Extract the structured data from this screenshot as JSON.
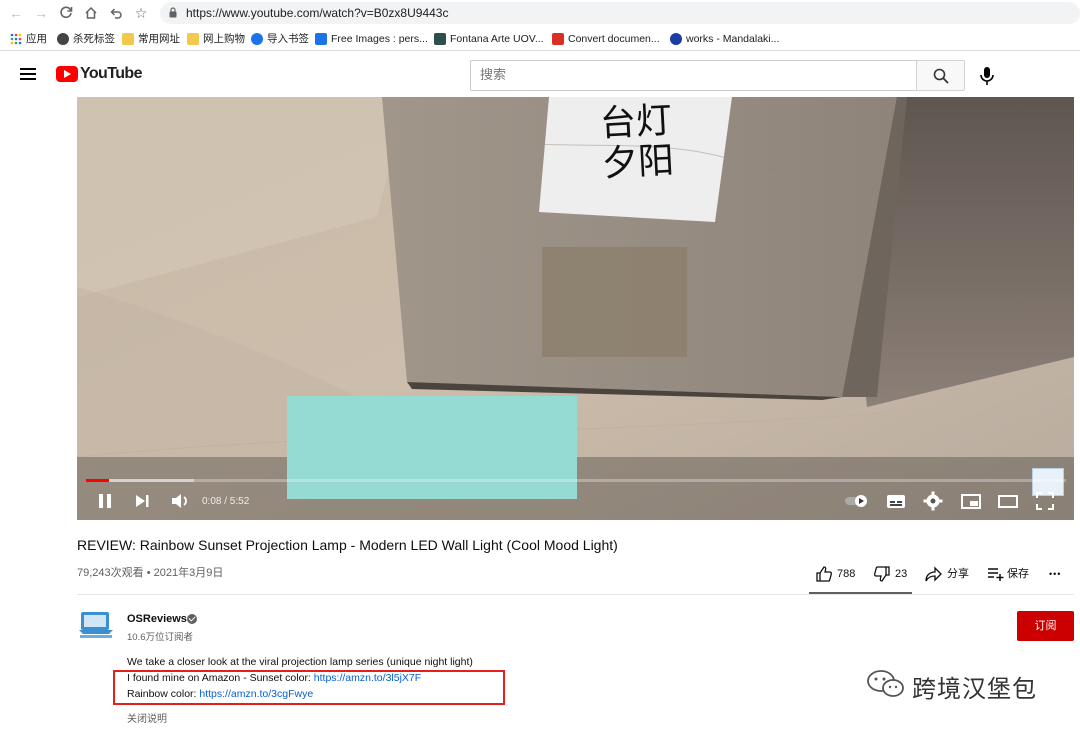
{
  "browser": {
    "url": "https://www.youtube.com/watch?v=B0zx8U9443c",
    "bookmarks": [
      {
        "label": "应用",
        "color": "#1a73e8"
      },
      {
        "label": "杀死标签",
        "color": "#444444"
      },
      {
        "label": "常用网址",
        "color": "#f2c94c"
      },
      {
        "label": "网上购物",
        "color": "#f2c94c"
      },
      {
        "label": "导入书签",
        "color": "#1a73e8"
      },
      {
        "label": "Free Images : pers...",
        "color": "#1a73e8"
      },
      {
        "label": "Fontana Arte UOV...",
        "color": "#2f4f4f"
      },
      {
        "label": "Convert documen...",
        "color": "#d93025"
      },
      {
        "label": "works - Mandalaki...",
        "color": "#1a3da8"
      }
    ]
  },
  "youtube": {
    "logo_text": "YouTube",
    "search_placeholder": "搜索"
  },
  "player": {
    "box_label_line1": "台灯",
    "box_label_line2": "夕阳",
    "time_current": "0:08",
    "time_total": "5:52",
    "time_display": "0:08 / 5:52",
    "progress_fraction": 0.023,
    "buffered_fraction": 0.11
  },
  "video": {
    "title": "REVIEW: Rainbow Sunset Projection Lamp - Modern LED Wall Light (Cool Mood Light)",
    "meta": "79,243次观看 • 2021年3月9日",
    "likes": "788",
    "dislikes": "23",
    "share_label": "分享",
    "save_label": "保存",
    "more_label": "•••"
  },
  "channel": {
    "name": "OSReviews",
    "subscribers": "10.6万位订阅者",
    "subscribe_label": "订阅"
  },
  "description": {
    "line1": "We take a closer look at the viral projection lamp series (unique night light)",
    "line2_text": "I found mine on Amazon - Sunset color: ",
    "line2_link": "https://amzn.to/3l5jX7F",
    "line3_text": "Rainbow color: ",
    "line3_link": "https://amzn.to/3cgFwye",
    "collapse_label": "关闭说明"
  },
  "watermark": {
    "text": "跨境汉堡包"
  },
  "colors": {
    "youtube_red": "#ff0000",
    "subscribe_red": "#cc0000",
    "link_blue": "#065fd4",
    "highlight_box": "#e3201b"
  }
}
